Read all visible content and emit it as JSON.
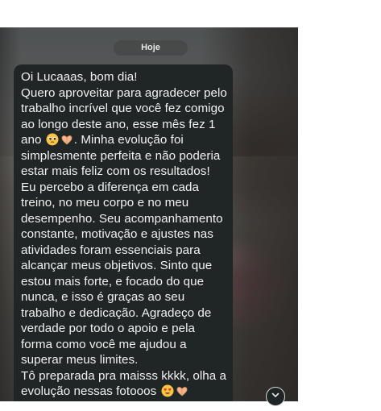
{
  "date_divider": "Hoje",
  "message": {
    "line1": "Oi Lucaaas, bom dia!\nQuero aproveitar para agradecer pelo trabalho incrível que você fez comigo ao longo deste ano, esse mês fez 1 ano",
    "line2": ". Minha evolução foi simplesmente perfeita e não poderia estar mais feliz com os resultados! Eu percebo a diferença em cada treino, no meu corpo e no meu desempenho. Seu acompanhamento constante, motivação e ajustes nas atividades foram essenciais para alcançar meus objetivos. Sinto que estou mais forte, e focado do que nunca, e isso é graças ao seu trabalho e dedicação. Agradeço de verdade por todo o apoio e pela forma como você me ajudou a superar meus limites.\nTô preparada pra maisss kkkk, olha a evolução nessas fotooos",
    "emojis_1": [
      "pleading-face-icon",
      "heart-hands-icon"
    ],
    "emojis_2": [
      "heart-eyes-icon",
      "heart-hands-icon"
    ]
  },
  "scroll_button": {
    "icon": "chevron-down-icon"
  }
}
